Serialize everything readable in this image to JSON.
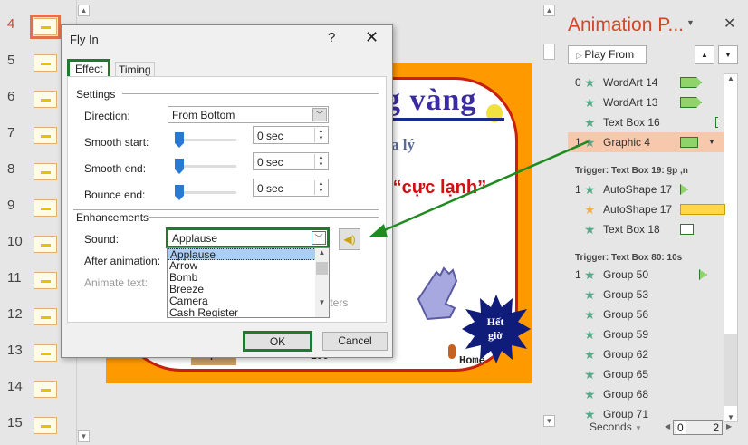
{
  "thumbnails": {
    "numbers": [
      "4",
      "5",
      "6",
      "7",
      "8",
      "9",
      "10",
      "11",
      "12",
      "13",
      "14",
      "15"
    ],
    "selected": "4"
  },
  "slide": {
    "title_fragment": "g vàng",
    "subtitle_fragment": "a lý",
    "red_text": "à “cực lạnh”",
    "burst_text_1": "Hết",
    "burst_text_2": "giờ",
    "home": "Home",
    "bottom_label": "Đáp án",
    "bottom_value": "100"
  },
  "dialog": {
    "title": "Fly In",
    "help": "?",
    "close": "✕",
    "tabs": [
      "Effect",
      "Timing"
    ],
    "settings_label": "Settings",
    "direction_label": "Direction:",
    "direction_value": "From Bottom",
    "smooth_start_label": "Smooth start:",
    "smooth_start_value": "0 sec",
    "smooth_end_label": "Smooth end:",
    "smooth_end_value": "0 sec",
    "bounce_end_label": "Bounce end:",
    "bounce_end_value": "0 sec",
    "enhancements_label": "Enhancements",
    "sound_label": "Sound:",
    "sound_value": "Applause",
    "after_animation_label": "After animation:",
    "animate_text_label": "Animate text:",
    "letters_partial": "tters",
    "sound_options": [
      "Applause",
      "Arrow",
      "Bomb",
      "Breeze",
      "Camera",
      "Cash Register"
    ],
    "ok": "OK",
    "cancel": "Cancel"
  },
  "animation_pane": {
    "title": "Animation P...",
    "close": "✕",
    "play_from": "Play From",
    "items": [
      {
        "num": "0",
        "name": "WordArt 14"
      },
      {
        "num": "",
        "name": "WordArt 13"
      },
      {
        "num": "",
        "name": "Text Box 16"
      },
      {
        "num": "1",
        "name": "Graphic 4",
        "selected": true
      }
    ],
    "trigger1": "Trigger: Text Box 19: §p ,n",
    "trigger1_items": [
      {
        "num": "1",
        "name": "AutoShape 17"
      },
      {
        "num": "",
        "name": "AutoShape 17",
        "emphasis": true
      },
      {
        "num": "",
        "name": "Text Box 18"
      }
    ],
    "trigger2": "Trigger: Text Box 80: 10s",
    "trigger2_items": [
      {
        "num": "1",
        "name": "Group 50"
      },
      {
        "num": "",
        "name": "Group 53"
      },
      {
        "num": "",
        "name": "Group 56"
      },
      {
        "num": "",
        "name": "Group 59"
      },
      {
        "num": "",
        "name": "Group 62"
      },
      {
        "num": "",
        "name": "Group 65"
      },
      {
        "num": "",
        "name": "Group 68"
      },
      {
        "num": "",
        "name": "Group 71"
      }
    ],
    "seconds": "Seconds",
    "timeline_start": "0",
    "timeline_end": "2"
  },
  "colors": {
    "accent": "#d24726",
    "highlight_green": "#1f7a2f",
    "selected_row": "#f8c8ac"
  }
}
